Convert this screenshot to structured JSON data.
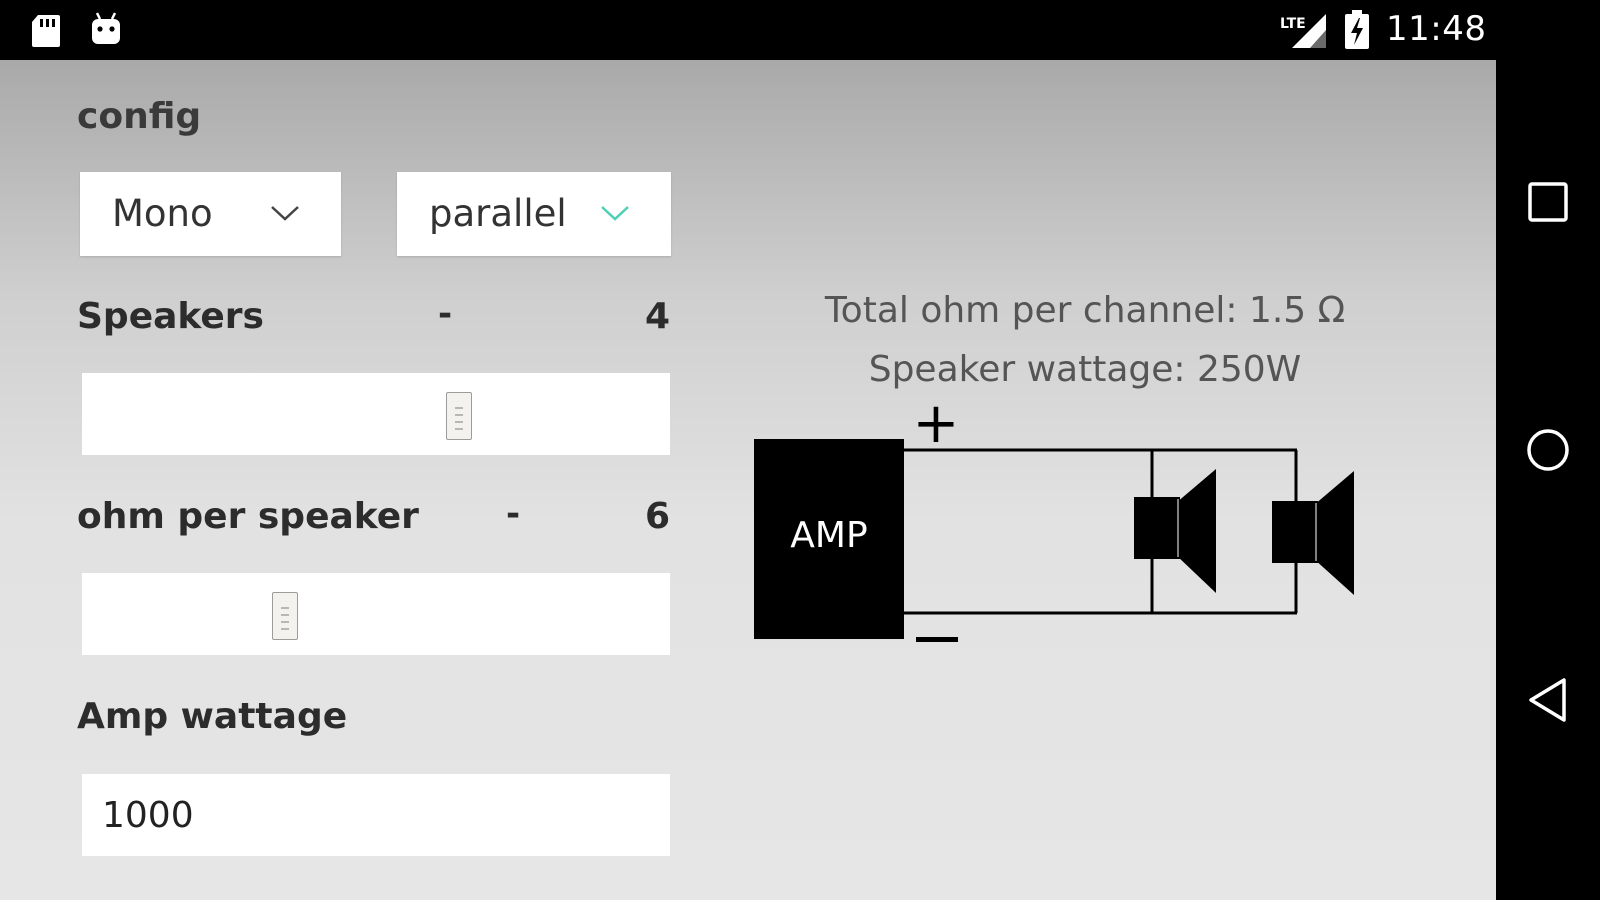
{
  "status_bar": {
    "time": "11:48",
    "network": "LTE",
    "icons": [
      "sd-card-icon",
      "android-debug-icon",
      "lte-signal-icon",
      "battery-charging-icon"
    ]
  },
  "config": {
    "label": "config",
    "mode_select": {
      "selected": "Mono"
    },
    "wiring_select": {
      "selected": "parallel"
    }
  },
  "speakers": {
    "label": "Speakers",
    "minus": "-",
    "value": "4",
    "slider_fraction": 0.64
  },
  "ohm_per_speaker": {
    "label": "ohm per speaker",
    "minus": "-",
    "value": "6",
    "slider_fraction": 0.34
  },
  "amp_wattage": {
    "label": "Amp wattage",
    "value": "1000"
  },
  "results": {
    "total_ohm": "Total ohm per channel: 1.5 Ω",
    "speaker_wattage": "Speaker wattage: 250W"
  },
  "diagram": {
    "amp_label": "AMP",
    "plus": "+",
    "minus": "−"
  },
  "nav_bar": {
    "icons": [
      "recents-square-icon",
      "home-circle-icon",
      "back-triangle-icon"
    ]
  },
  "colors": {
    "accent": "#4dd0b4",
    "status_bar": "#000000",
    "panel_bg": "#ffffff"
  }
}
